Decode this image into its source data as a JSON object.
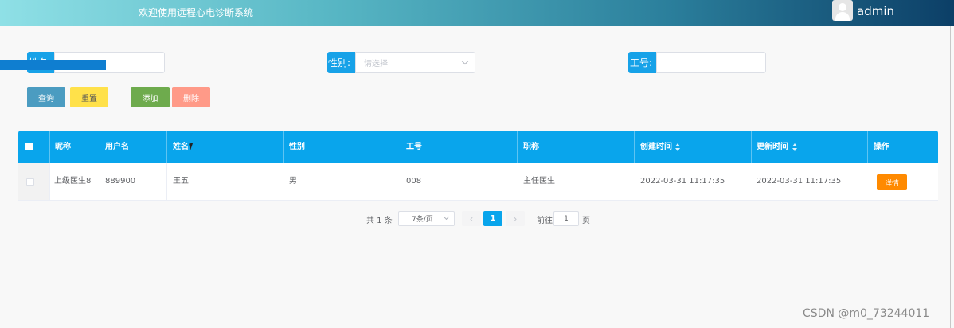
{
  "header": {
    "title": "欢迎使用远程心电诊断系统",
    "username": "admin"
  },
  "search": {
    "name_label": "姓名:",
    "name_value": "",
    "gender_label": "性别:",
    "gender_placeholder": "请选择",
    "jobno_label": "工号:",
    "jobno_value": ""
  },
  "buttons": {
    "query": "查询",
    "reset": "重置",
    "add": "添加",
    "delete": "删除"
  },
  "table": {
    "headers": [
      "昵称",
      "用户名",
      "姓名",
      "性别",
      "工号",
      "职称",
      "创建时间",
      "更新时间",
      "操作"
    ],
    "rows": [
      {
        "nickname": "上级医生8",
        "username": "889900",
        "name": "王五",
        "gender": "男",
        "jobno": "008",
        "title": "主任医生",
        "created": "2022-03-31 11:17:35",
        "updated": "2022-03-31 11:17:35",
        "action": "详情"
      }
    ]
  },
  "pagination": {
    "total": "共 1 条",
    "page_size": "7条/页",
    "prev": "‹",
    "current": "1",
    "next": "›",
    "goto_label": "前往",
    "goto_value": "1",
    "page_unit": "页"
  },
  "watermark": "CSDN @m0_73244011",
  "colors": {
    "primary": "#09a5ec",
    "query": "#4b9cc1",
    "reset": "#ffe14a",
    "add": "#6eab4d",
    "delete": "#ff9a88",
    "detail": "#ff8a00"
  }
}
